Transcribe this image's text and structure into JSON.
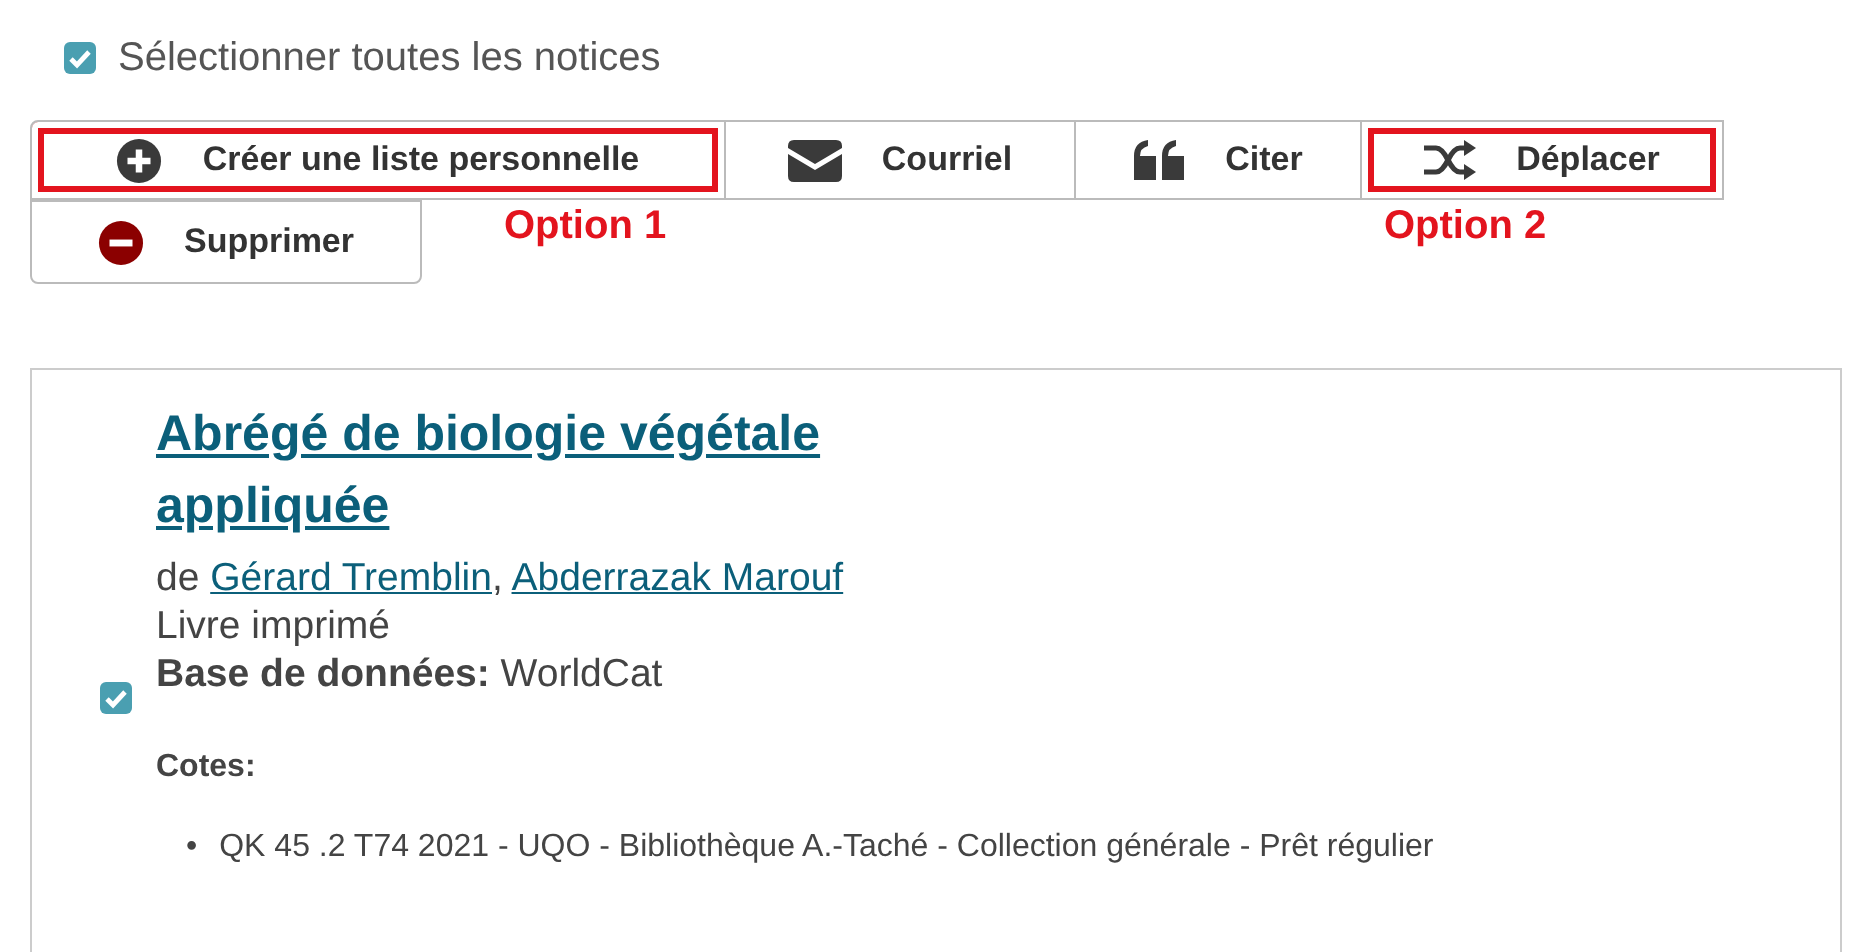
{
  "select_all": {
    "label": "Sélectionner toutes les notices",
    "checked": true
  },
  "actions": [
    {
      "label": "Créer une liste personnelle",
      "kind": "create",
      "highlighted": true
    },
    {
      "label": "Courriel",
      "kind": "email",
      "highlighted": false
    },
    {
      "label": "Citer",
      "kind": "cite",
      "highlighted": false
    },
    {
      "label": "Déplacer",
      "kind": "move",
      "highlighted": true
    },
    {
      "label": "Supprimer",
      "kind": "delete",
      "highlighted": false
    }
  ],
  "annotations": [
    {
      "text": "Option 1"
    },
    {
      "text": "Option 2"
    }
  ],
  "record": {
    "checked": true,
    "title": "Abrégé de biologie végétale appliquée",
    "by": "de",
    "authors": [
      "Gérard Tremblin",
      "Abderrazak Marouf"
    ],
    "author_separator": ",",
    "format": "Livre imprimé",
    "database_label": "Base de données:",
    "database": "WorldCat",
    "call_numbers_label": "Cotes:",
    "bullet": "•",
    "call_numbers": [
      "QK 45 .2 T74 2021 - UQO - Bibliothèque A.-Taché - Collection générale - Prêt régulier"
    ]
  }
}
